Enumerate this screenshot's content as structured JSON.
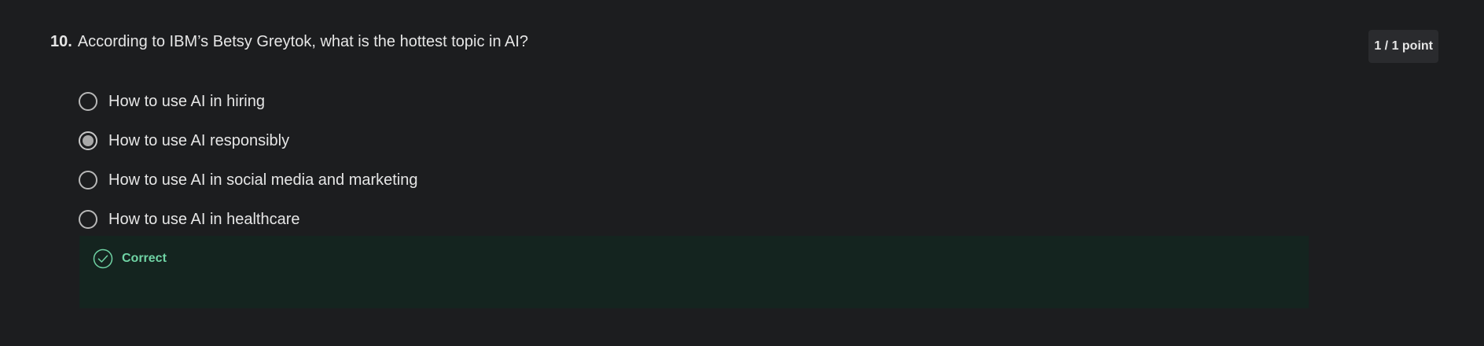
{
  "question": {
    "number": "10.",
    "text": "According to IBM’s Betsy Greytok, what is the hottest topic in AI?",
    "points": "1 / 1 point",
    "options": [
      {
        "label": "How to use AI in hiring",
        "selected": false
      },
      {
        "label": "How to use AI responsibly",
        "selected": true
      },
      {
        "label": "How to use AI in social media and marketing",
        "selected": false
      },
      {
        "label": "How to use AI in healthcare",
        "selected": false
      }
    ],
    "feedback": {
      "status": "Correct",
      "icon": "check-circle-icon",
      "color": "#6fd3a4",
      "background": "#14241f"
    }
  },
  "colors": {
    "page_background": "#1c1d1f",
    "text": "#e6e6e6",
    "points_badge_background": "#2a2b2e"
  }
}
